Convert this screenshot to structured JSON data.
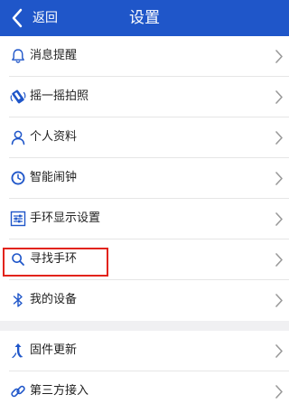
{
  "header": {
    "back_label": "返回",
    "title": "设置",
    "background_color": "#1f56c9"
  },
  "colors": {
    "icon_blue": "#1f56c9",
    "highlight_red": "#e2231a"
  },
  "settings_group_1": [
    {
      "label": "消息提醒",
      "icon": "bell-icon"
    },
    {
      "label": "摇一摇拍照",
      "icon": "shake-phone-icon"
    },
    {
      "label": "个人资料",
      "icon": "person-icon"
    },
    {
      "label": "智能闹钟",
      "icon": "clock-icon"
    },
    {
      "label": "手环显示设置",
      "icon": "sliders-icon"
    },
    {
      "label": "寻找手环",
      "icon": "search-icon"
    },
    {
      "label": "我的设备",
      "icon": "bluetooth-icon",
      "highlighted": true
    }
  ],
  "settings_group_2": [
    {
      "label": "固件更新",
      "icon": "update-arrow-icon"
    },
    {
      "label": "第三方接入",
      "icon": "link-icon"
    }
  ]
}
